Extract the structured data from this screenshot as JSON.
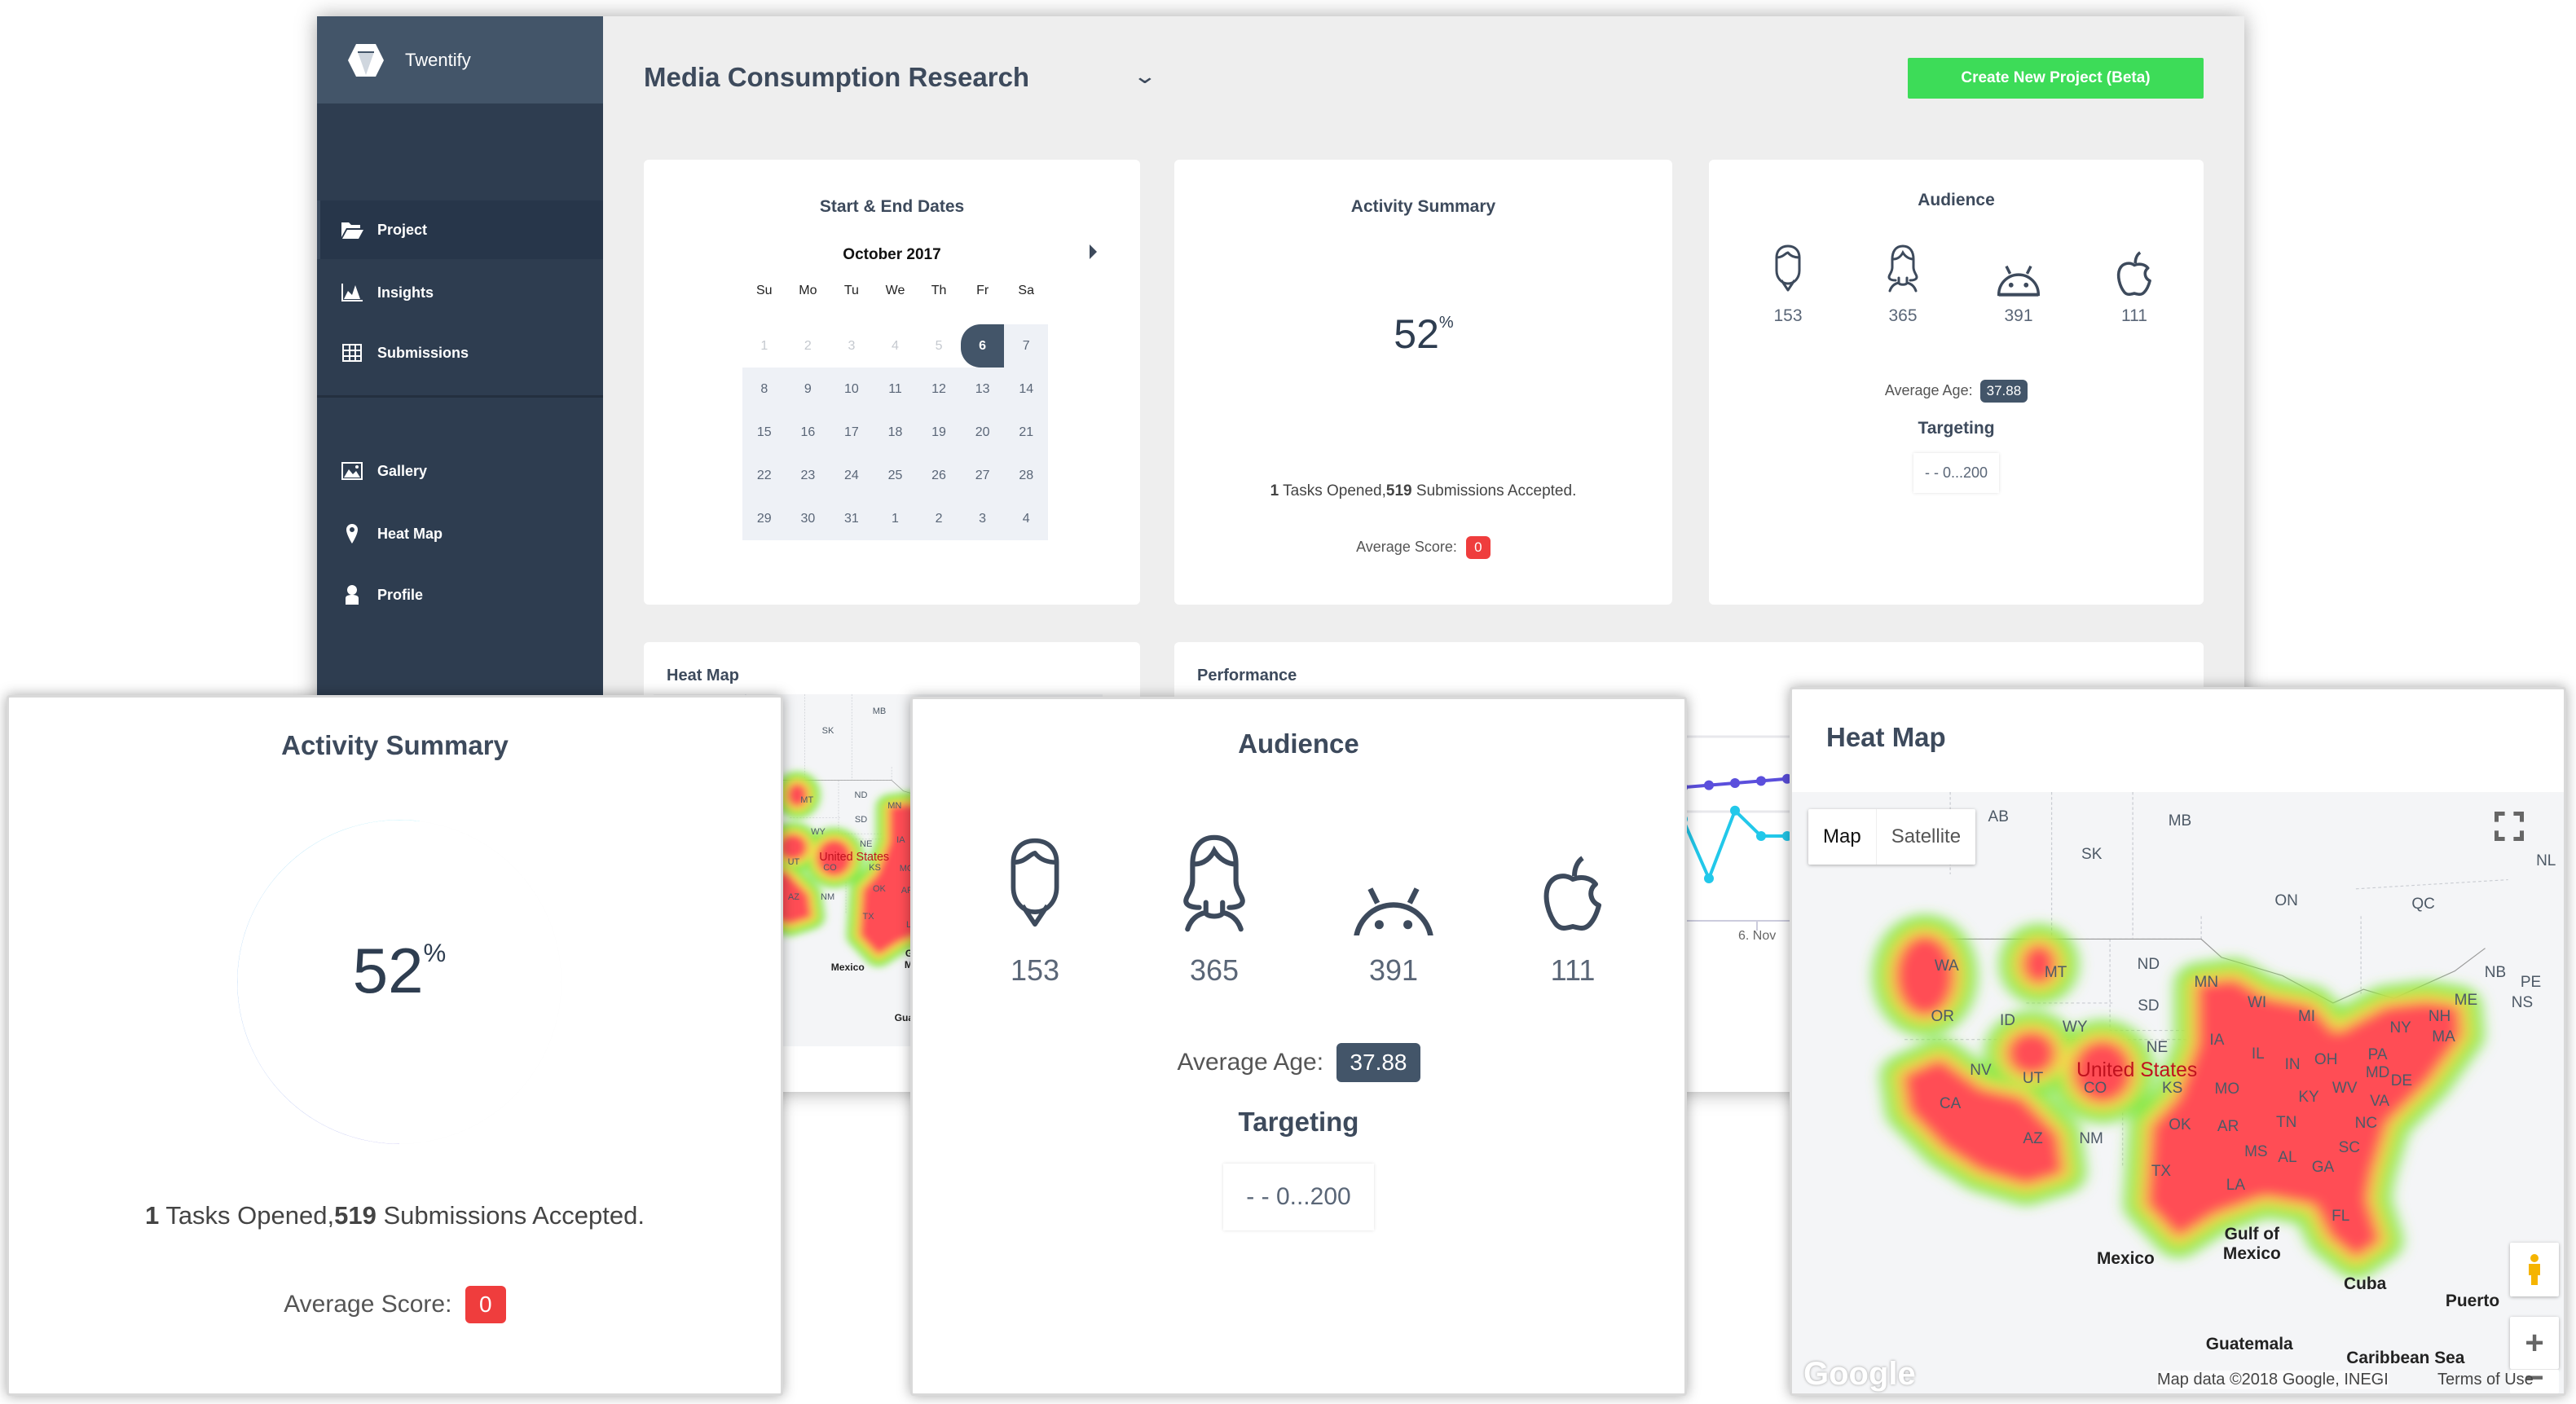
{
  "app": {
    "name": "Twentify"
  },
  "sidebar": {
    "items": [
      {
        "label": "Project",
        "icon": "folder-open-icon",
        "active": true
      },
      {
        "label": "Insights",
        "icon": "area-chart-icon"
      },
      {
        "label": "Submissions",
        "icon": "table-grid-icon"
      },
      {
        "label": "Gallery",
        "icon": "image-icon"
      },
      {
        "label": "Heat Map",
        "icon": "map-pin-icon"
      },
      {
        "label": "Profile",
        "icon": "user-icon"
      }
    ]
  },
  "header": {
    "title": "Media Consumption Research",
    "create_label": "Create New Project (Beta)"
  },
  "calendar": {
    "title": "Start & End Dates",
    "month": "October 2017",
    "day_headers": [
      "Su",
      "Mo",
      "Tu",
      "We",
      "Th",
      "Fr",
      "Sa"
    ],
    "days": [
      "1",
      "2",
      "3",
      "4",
      "5",
      "6",
      "7",
      "8",
      "9",
      "10",
      "11",
      "12",
      "13",
      "14",
      "15",
      "16",
      "17",
      "18",
      "19",
      "20",
      "21",
      "22",
      "23",
      "24",
      "25",
      "26",
      "27",
      "28",
      "29",
      "30",
      "31",
      "1",
      "2",
      "3",
      "4"
    ],
    "selected": "6"
  },
  "activity": {
    "title": "Activity Summary",
    "percent": 52,
    "percent_sign": "%",
    "tasks_count": "1",
    "tasks_text": " Tasks Opened,",
    "submissions_count": "519",
    "submissions_text": " Submissions Accepted.",
    "avg_score_label": "Average Score:",
    "avg_score": "0"
  },
  "audience": {
    "title": "Audience",
    "groups": [
      {
        "icon": "male-icon",
        "count": "153"
      },
      {
        "icon": "female-icon",
        "count": "365"
      },
      {
        "icon": "android-icon",
        "count": "391"
      },
      {
        "icon": "apple-icon",
        "count": "111"
      }
    ],
    "avg_age_label": "Average Age:",
    "avg_age": "37.88",
    "targeting_label": "Targeting",
    "targeting_value": "- - 0...200"
  },
  "heatmap": {
    "title": "Heat Map",
    "map_type_options": [
      "Map",
      "Satellite"
    ],
    "map_type_selected": "Map",
    "labels": [
      "AB",
      "MB",
      "SK",
      "ON",
      "QC",
      "NL",
      "NB",
      "PE",
      "NS",
      "WA",
      "MT",
      "ND",
      "MN",
      "OR",
      "ID",
      "WY",
      "SD",
      "WI",
      "MI",
      "NY",
      "NH",
      "MA",
      "ME",
      "IA",
      "NE",
      "NV",
      "UT",
      "United States",
      "CO",
      "KS",
      "IL",
      "IN",
      "OH",
      "PA",
      "MD",
      "DE",
      "WV",
      "VA",
      "KY",
      "MO",
      "CA",
      "AZ",
      "NM",
      "OK",
      "AR",
      "TN",
      "NC",
      "SC",
      "MS",
      "AL",
      "GA",
      "TX",
      "LA",
      "FL",
      "Gulf of Mexico",
      "Mexico",
      "Cuba",
      "Puerto",
      "Guatemala",
      "Caribbean Sea"
    ],
    "attribution": "Map data ©2018 Google, INEGI",
    "terms": "Terms of Use",
    "logo": "Google",
    "colors": {
      "hot": "#ff4d55",
      "warm": "#f2e04a",
      "cool": "#7ee83a"
    }
  },
  "performance": {
    "title": "Performance",
    "x_tick": "6. Nov",
    "series": [
      {
        "color": "#5b4fdc",
        "values": [
          62,
          63,
          63,
          64,
          65,
          66,
          67,
          68,
          69,
          70
        ]
      },
      {
        "color": "#22c8ea",
        "values": [
          40,
          48,
          48,
          20,
          52,
          40,
          40,
          30,
          45,
          38
        ]
      }
    ]
  }
}
